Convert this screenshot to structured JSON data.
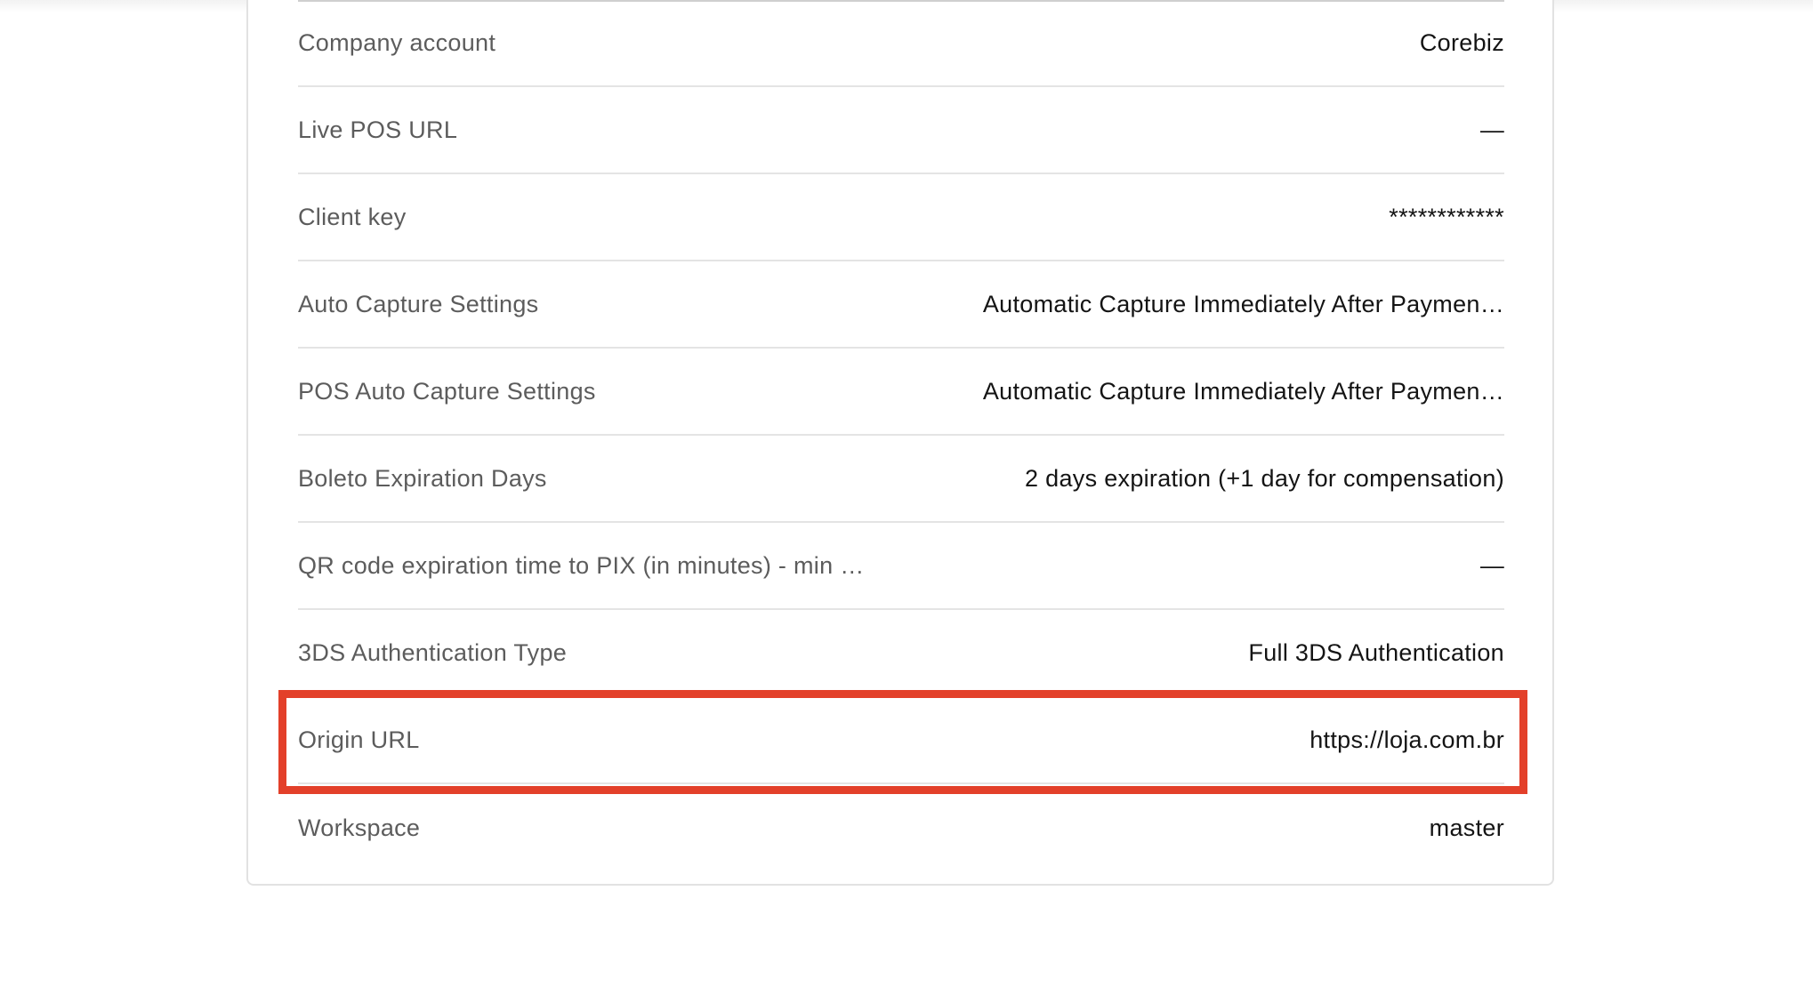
{
  "highlight_color": "#e3402a",
  "rows": [
    {
      "label": "Company account",
      "value": "Corebiz"
    },
    {
      "label": "Live POS URL",
      "value": "—"
    },
    {
      "label": "Client key",
      "value": "************"
    },
    {
      "label": "Auto Capture Settings",
      "value": "Automatic Capture Immediately After Paymen…"
    },
    {
      "label": "POS Auto Capture Settings",
      "value": "Automatic Capture Immediately After Paymen…"
    },
    {
      "label": "Boleto Expiration Days",
      "value": "2 days expiration (+1 day for compensation)"
    },
    {
      "label": "QR code expiration time to PIX (in minutes) - min …",
      "value": "—"
    },
    {
      "label": "3DS Authentication Type",
      "value": "Full 3DS Authentication"
    },
    {
      "label": "Origin URL",
      "value": "https://loja.com.br"
    },
    {
      "label": "Workspace",
      "value": "master"
    }
  ]
}
